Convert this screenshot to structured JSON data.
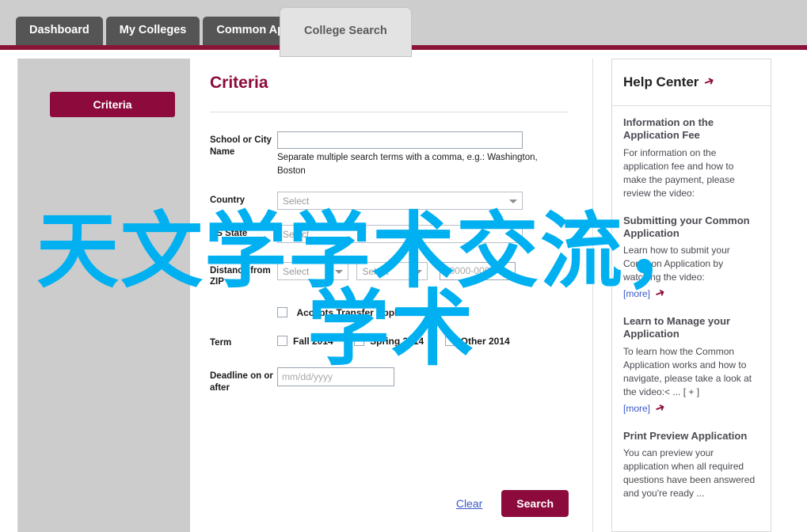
{
  "tabs": [
    {
      "label": "Dashboard",
      "active": false
    },
    {
      "label": "My Colleges",
      "active": false
    },
    {
      "label": "Common App",
      "active": false
    },
    {
      "label": "College Search",
      "active": true
    }
  ],
  "sidebar": {
    "criteria_button": "Criteria"
  },
  "main": {
    "title": "Criteria",
    "fields": {
      "school_city": {
        "label": "School or City Name",
        "value": "",
        "placeholder": "",
        "hint": "Separate multiple search terms with a comma, e.g.: Washington, Boston"
      },
      "country": {
        "label": "Country",
        "select_placeholder": "Select"
      },
      "us_state": {
        "label": "US State",
        "select_placeholder": "Select"
      },
      "distance_zip": {
        "label": "Distance from ZIP",
        "select1_placeholder": "Select",
        "select2_placeholder": "Select",
        "zip_placeholder": "00000-0000",
        "zip_value": ""
      },
      "transfer": {
        "label": "Accepts Transfer Applications",
        "checked": false
      },
      "term": {
        "label": "Term",
        "options": [
          {
            "label": "Fall 2014",
            "checked": false
          },
          {
            "label": "Spring 2014",
            "checked": false
          },
          {
            "label": "Other 2014",
            "checked": false
          }
        ]
      },
      "deadline": {
        "label": "Deadline on or after",
        "placeholder": "mm/dd/yyyy",
        "value": ""
      }
    },
    "actions": {
      "clear": "Clear",
      "search": "Search"
    }
  },
  "help": {
    "title": "Help Center",
    "articles": [
      {
        "title": "Information on the Application Fee",
        "body": "For information on the application fee and how to make the payment, please review the video:",
        "more": ""
      },
      {
        "title": "Submitting your Common Application",
        "body": "Learn how to submit your Common Application by watching the video:",
        "more": "[more]"
      },
      {
        "title": "Learn to Manage your Application",
        "body": "To learn how the Common Application works and how to navigate, please take a look at the video:< ... [ + ]",
        "more": "[more]"
      },
      {
        "title": "Print Preview Application",
        "body": "You can preview your application when all required questions have been answered and you're ready ...",
        "more": ""
      }
    ]
  },
  "overlay": {
    "line1": "天文学学术交流，",
    "line2": "学术",
    "color": "#00b0f0"
  },
  "colors": {
    "brand_maroon": "#8c0b3c",
    "rule_maroon": "#8c1338",
    "tab_inactive": "#555555",
    "tab_active_bg": "#e3e3e3",
    "rail_gray": "#cccccc",
    "link_blue": "#3a58c8"
  }
}
